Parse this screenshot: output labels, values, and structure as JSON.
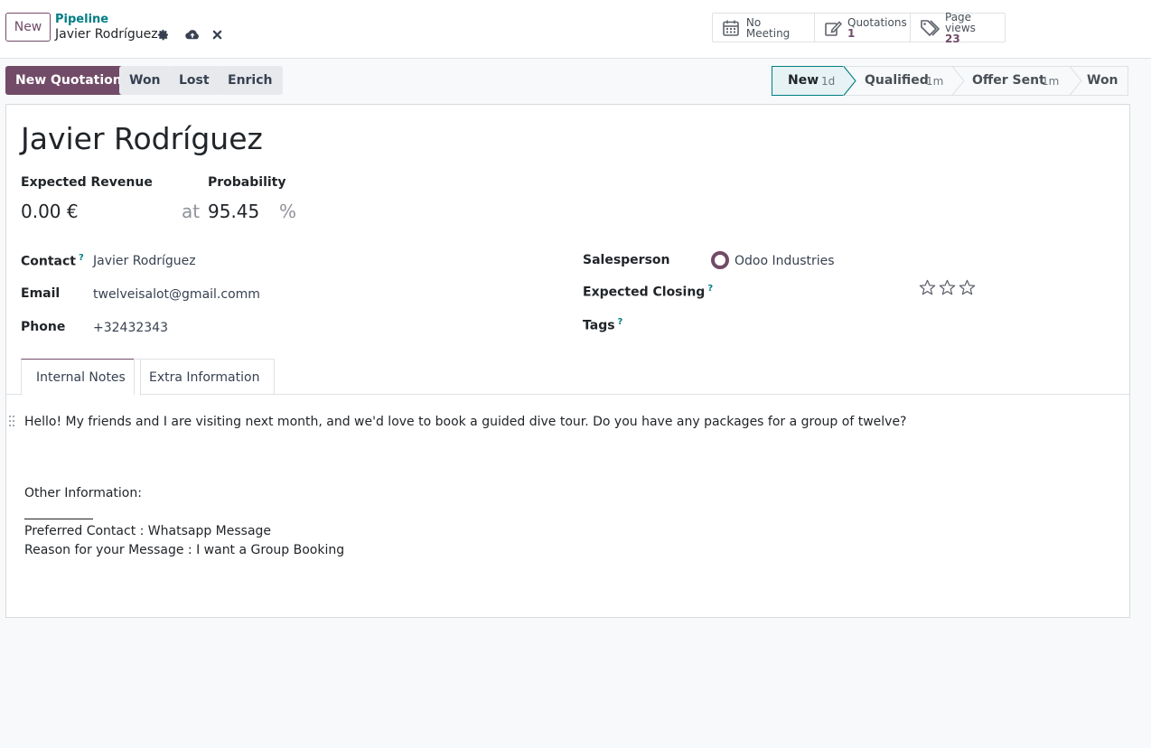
{
  "topbar": {
    "new_label": "New",
    "breadcrumb_parent": "Pipeline",
    "breadcrumb_current": "Javier Rodríguez",
    "smart_buttons": [
      {
        "icon": "calendar-icon",
        "label": "No Meeting",
        "count": ""
      },
      {
        "icon": "edit-icon",
        "label": "Quotations",
        "count": "1"
      },
      {
        "icon": "tags-icon",
        "label": "Page views",
        "count": "23"
      }
    ]
  },
  "actions": {
    "new_quotation": "New Quotation",
    "won": "Won",
    "lost": "Lost",
    "enrich": "Enrich"
  },
  "stages": [
    {
      "label": "New",
      "duration": "1d",
      "active": true
    },
    {
      "label": "Qualified",
      "duration": "1m",
      "active": false
    },
    {
      "label": "Offer Sent",
      "duration": "1m",
      "active": false
    },
    {
      "label": "Won",
      "duration": "",
      "active": false
    }
  ],
  "form": {
    "title": "Javier Rodríguez",
    "expected_revenue_label": "Expected Revenue",
    "expected_revenue_value": "0.00 €",
    "at_label": "at",
    "probability_label": "Probability",
    "probability_value": "95.45",
    "percent": "%",
    "contact_label": "Contact",
    "contact_value": "Javier Rodríguez",
    "email_label": "Email",
    "email_value": "twelveisalot@gmail.comm",
    "phone_label": "Phone",
    "phone_value": "+32432343",
    "salesperson_label": "Salesperson",
    "salesperson_value": "Odoo Industries",
    "expected_closing_label": "Expected Closing",
    "tags_label": "Tags",
    "help_mark": "?",
    "priority_stars": 0
  },
  "tabs": {
    "internal_notes": "Internal Notes",
    "extra_information": "Extra Information"
  },
  "notes": {
    "line1": "Hello! My friends and I are visiting next month, and we'd love to book a guided dive tour. Do you have any packages for a group of twelve?",
    "line2": "Other Information:",
    "line3": "Preferred Contact : Whatsapp Message",
    "line4": "Reason for your Message : I want a Group Booking"
  },
  "colors": {
    "brand": "#714b67",
    "accent": "#017e84"
  }
}
